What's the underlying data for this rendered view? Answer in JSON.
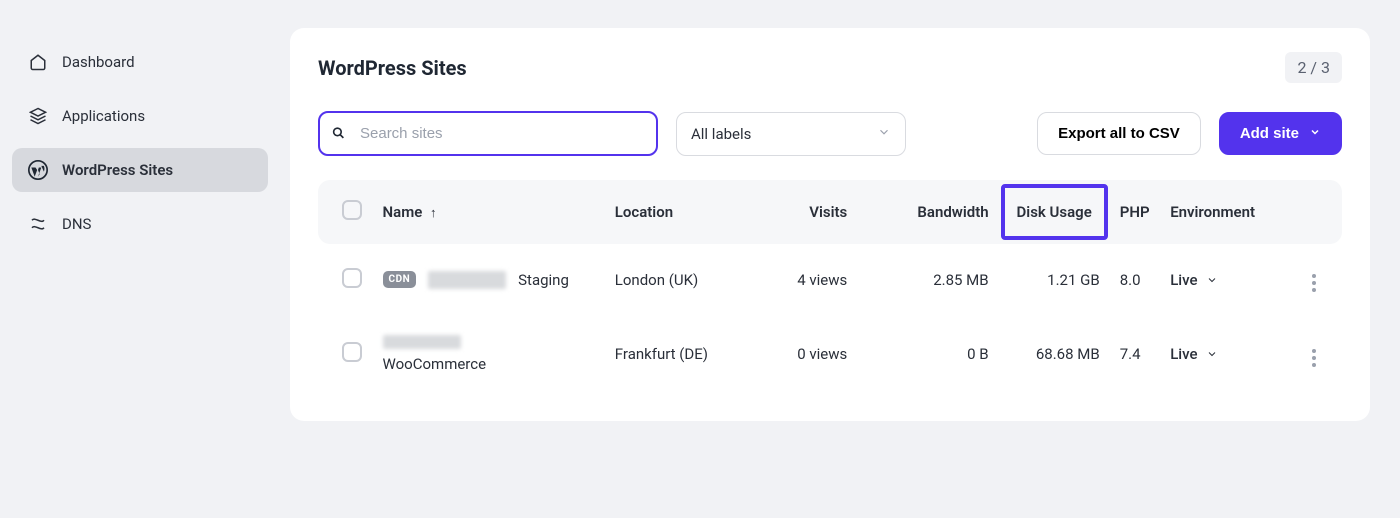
{
  "sidebar": {
    "items": [
      {
        "label": "Dashboard"
      },
      {
        "label": "Applications"
      },
      {
        "label": "WordPress Sites"
      },
      {
        "label": "DNS"
      }
    ]
  },
  "header": {
    "title": "WordPress Sites",
    "counter": "2 / 3"
  },
  "toolbar": {
    "search_placeholder": "Search sites",
    "labels_filter": "All labels",
    "export_label": "Export all to CSV",
    "add_site_label": "Add site"
  },
  "columns": {
    "name": "Name",
    "location": "Location",
    "visits": "Visits",
    "bandwidth": "Bandwidth",
    "disk_usage": "Disk Usage",
    "php": "PHP",
    "environment": "Environment"
  },
  "badges": {
    "cdn": "CDN"
  },
  "rows": [
    {
      "name_suffix": "Staging",
      "has_cdn": true,
      "location": "London (UK)",
      "visits": "4 views",
      "bandwidth": "2.85 MB",
      "disk_usage": "1.21 GB",
      "php": "8.0",
      "environment": "Live"
    },
    {
      "name_suffix": "WooCommerce",
      "has_cdn": false,
      "location": "Frankfurt (DE)",
      "visits": "0 views",
      "bandwidth": "0 B",
      "disk_usage": "68.68 MB",
      "php": "7.4",
      "environment": "Live"
    }
  ]
}
